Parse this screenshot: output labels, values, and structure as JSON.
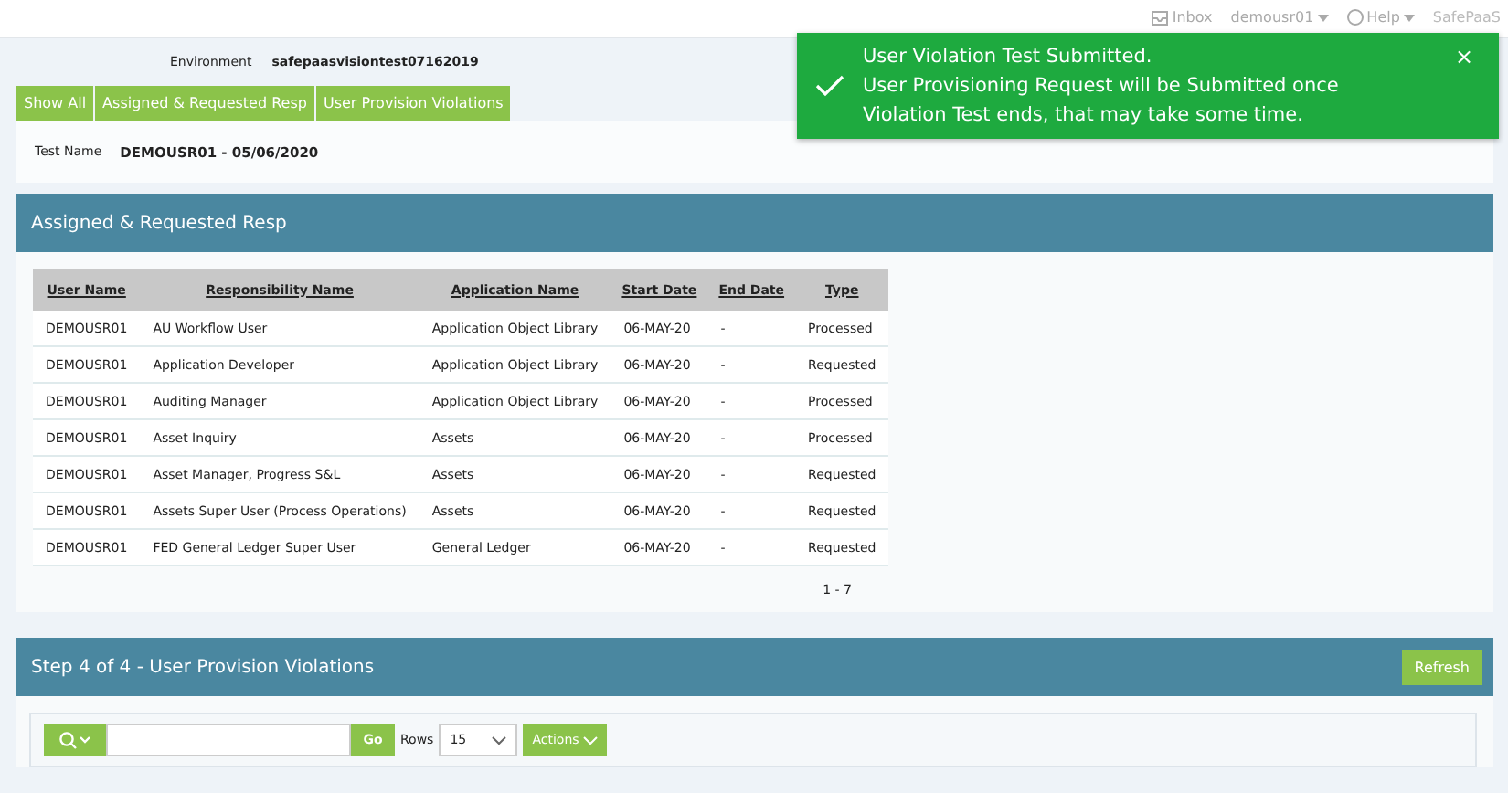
{
  "header": {
    "items": [
      {
        "kind": "inbox",
        "label": "Inbox"
      },
      {
        "kind": "user",
        "label": "demousr01"
      },
      {
        "kind": "help",
        "label": "Help"
      },
      {
        "kind": "brand",
        "label": "SafePaaS"
      }
    ]
  },
  "toast": {
    "lines": [
      "User Violation Test Submitted.",
      "User Provisioning Request will be Submitted once",
      "Violation Test ends, that may take some time."
    ],
    "close": "×"
  },
  "environment": {
    "label": "Environment",
    "value": "safepaasvisiontest07162019"
  },
  "tabs": [
    {
      "label": "Show All",
      "selected": false
    },
    {
      "label": "Assigned & Requested Resp",
      "selected": false
    },
    {
      "label": "User Provision Violations",
      "selected": false
    }
  ],
  "test": {
    "label": "Test Name",
    "value": "DEMOUSR01 - 05/06/2020"
  },
  "resp_region": {
    "title": "Assigned & Requested Resp",
    "table": {
      "columns": [
        "User Name",
        "Responsibility Name",
        "Application Name",
        "Start Date",
        "End Date",
        "Type"
      ],
      "rows": [
        [
          "DEMOUSR01",
          "AU Workflow User",
          "Application Object Library",
          "06-MAY-20",
          "-",
          "Processed"
        ],
        [
          "DEMOUSR01",
          "Application Developer",
          "Application Object Library",
          "06-MAY-20",
          "-",
          "Requested"
        ],
        [
          "DEMOUSR01",
          "Auditing Manager",
          "Application Object Library",
          "06-MAY-20",
          "-",
          "Processed"
        ],
        [
          "DEMOUSR01",
          "Asset Inquiry",
          "Assets",
          "06-MAY-20",
          "-",
          "Processed"
        ],
        [
          "DEMOUSR01",
          "Asset Manager, Progress S&L",
          "Assets",
          "06-MAY-20",
          "-",
          "Requested"
        ],
        [
          "DEMOUSR01",
          "Assets Super User (Process Operations)",
          "Assets",
          "06-MAY-20",
          "-",
          "Requested"
        ],
        [
          "DEMOUSR01",
          "FED General Ledger Super User",
          "General Ledger",
          "06-MAY-20",
          "-",
          "Requested"
        ]
      ]
    },
    "pagination": "1 - 7"
  },
  "violations_region": {
    "title": "Step 4 of 4 - User Provision Violations",
    "refresh": "Refresh",
    "toolbar": {
      "go": "Go",
      "rows_label": "Rows",
      "rows_value": "15",
      "actions": "Actions"
    }
  }
}
